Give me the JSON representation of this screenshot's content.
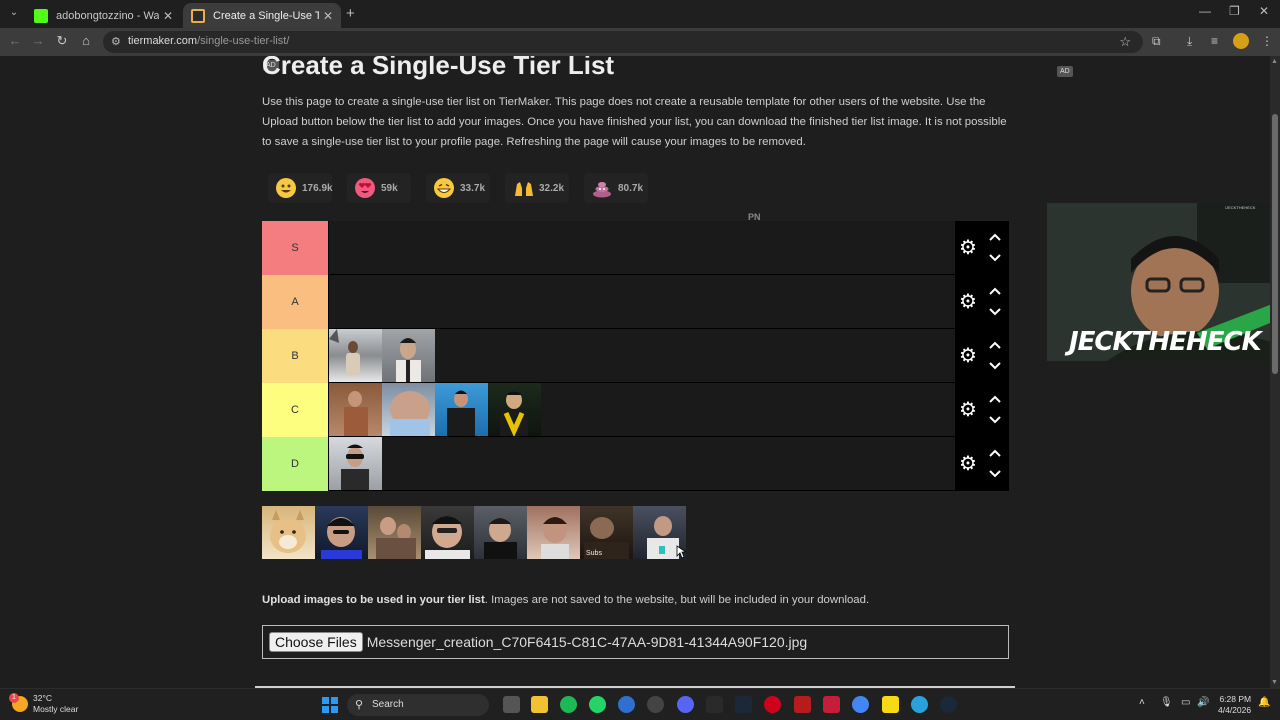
{
  "browser": {
    "tabs": [
      {
        "title": "adobongtozzino - Watch the V",
        "favicon_color": "#53fc18"
      },
      {
        "title": "Create a Single-Use Tier List (P",
        "favicon_color": "#e8b04b"
      }
    ],
    "url_domain": "tiermaker.com",
    "url_path": "/single-use-tier-list/"
  },
  "page": {
    "ad_label": "AD",
    "title": "Create a Single-Use Tier List",
    "intro": "Use this page to create a single-use tier list on TierMaker. This page does not create a reusable template for other users of the website. Use the Upload button below the tier list to add your images. Once you have finished your list, you can download the finished tier list image. It is not possible to save a single-use tier list to your profile page. Refreshing the page will cause your images to be removed.",
    "reactions": [
      {
        "icon": "grinning-face-icon",
        "count": "176.9k"
      },
      {
        "icon": "heart-eyes-icon",
        "count": "59k"
      },
      {
        "icon": "laughing-face-icon",
        "count": "33.7k"
      },
      {
        "icon": "raised-hands-icon",
        "count": "32.2k"
      },
      {
        "icon": "poop-icon",
        "count": "80.7k"
      }
    ],
    "stray_text": "PN",
    "tiers": [
      {
        "label": "S",
        "color": "#f47d7f",
        "items": 0
      },
      {
        "label": "A",
        "color": "#f9be80",
        "items": 0
      },
      {
        "label": "B",
        "color": "#fbdc7f",
        "items": 2
      },
      {
        "label": "C",
        "color": "#fdfe7f",
        "items": 4
      },
      {
        "label": "D",
        "color": "#bdf67f",
        "items": 1
      }
    ],
    "pool_count": 8,
    "pool_caption": "Subs",
    "upload_label_bold": "Upload images to be used in your tier list",
    "upload_label_rest": ". Images are not saved to the website, but will be included in your download.",
    "choose_files": "Choose Files",
    "file_name": "Messenger_creation_C70F6415-C81C-47AA-9D81-41344A90F120.jpg"
  },
  "overlay": {
    "logo_left": "JECK",
    "logo_mid": "THE",
    "logo_right": "HECK"
  },
  "taskbar": {
    "temp": "32°C",
    "weather": "Mostly clear",
    "search": "Search",
    "time": "6:28 PM",
    "date": "4/4/2026",
    "weather_badge": "1"
  }
}
